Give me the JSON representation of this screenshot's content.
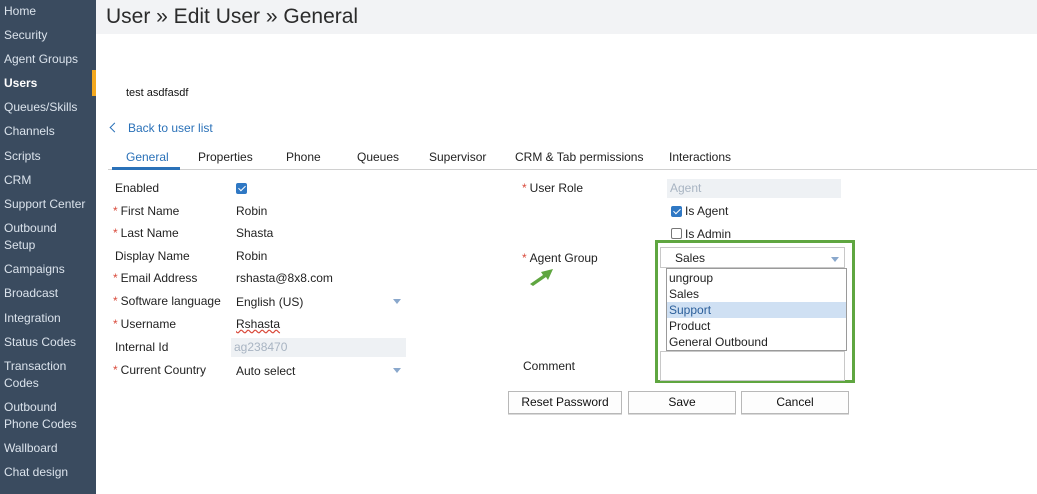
{
  "sidebar": {
    "items": [
      {
        "label": "Home"
      },
      {
        "label": "Security"
      },
      {
        "label": "Agent Groups"
      },
      {
        "label": "Users"
      },
      {
        "label": "Queues/Skills"
      },
      {
        "label": "Channels"
      },
      {
        "label": "Scripts"
      },
      {
        "label": "CRM"
      },
      {
        "label": "Support Center"
      },
      {
        "label": "Outbound"
      },
      {
        "label": "Setup"
      },
      {
        "label": "Campaigns"
      },
      {
        "label": "Broadcast"
      },
      {
        "label": "Integration"
      },
      {
        "label": "Status Codes"
      },
      {
        "label": "Transaction"
      },
      {
        "label": "Codes"
      },
      {
        "label": "Outbound"
      },
      {
        "label": "Phone Codes"
      },
      {
        "label": "Wallboard"
      },
      {
        "label": "Chat design"
      }
    ],
    "active_label": "Users"
  },
  "header": {
    "title": "User » Edit User » General"
  },
  "user_display": "test asdfasdf",
  "back_link": "Back to user list",
  "tabs": [
    {
      "label": "General"
    },
    {
      "label": "Properties"
    },
    {
      "label": "Phone"
    },
    {
      "label": "Queues"
    },
    {
      "label": "Supervisor"
    },
    {
      "label": "CRM & Tab permissions"
    },
    {
      "label": "Interactions"
    }
  ],
  "form": {
    "enabled_label": "Enabled",
    "enabled_checked": true,
    "first_name_label": "First Name",
    "first_name": "Robin",
    "last_name_label": "Last Name",
    "last_name": "Shasta",
    "display_name_label": "Display Name",
    "display_name": "Robin",
    "email_label": "Email Address",
    "email": "rshasta@8x8.com",
    "software_language_label": "Software language",
    "software_language": "English (US)",
    "username_label": "Username",
    "username": "Rshasta",
    "internal_id_label": "Internal Id",
    "internal_id": "ag238470",
    "current_country_label": "Current Country",
    "current_country": "Auto select",
    "user_role_label": "User Role",
    "user_role": "Agent",
    "is_agent_label": "Is Agent",
    "is_agent_checked": true,
    "is_admin_label": "Is Admin",
    "is_admin_checked": false,
    "agent_group_label": "Agent Group",
    "agent_group_value": "Sales",
    "agent_group_options": [
      "ungroup",
      "Sales",
      "Support",
      "Product",
      "General Outbound"
    ],
    "agent_group_highlighted": "Support",
    "comment_label": "Comment",
    "required_marker": "*"
  },
  "buttons": {
    "reset_password": "Reset Password",
    "save": "Save",
    "cancel": "Cancel"
  },
  "colors": {
    "sidebar_bg": "#3a4b5f",
    "accent_blue": "#2a71b8",
    "highlight_green": "#5fa640",
    "active_indicator": "#f3a81f",
    "required_red": "#d94b3c"
  },
  "icons": {
    "back": "chevron-left-icon",
    "dropdown": "chevron-down-icon",
    "pointer": "green-arrow-icon"
  }
}
